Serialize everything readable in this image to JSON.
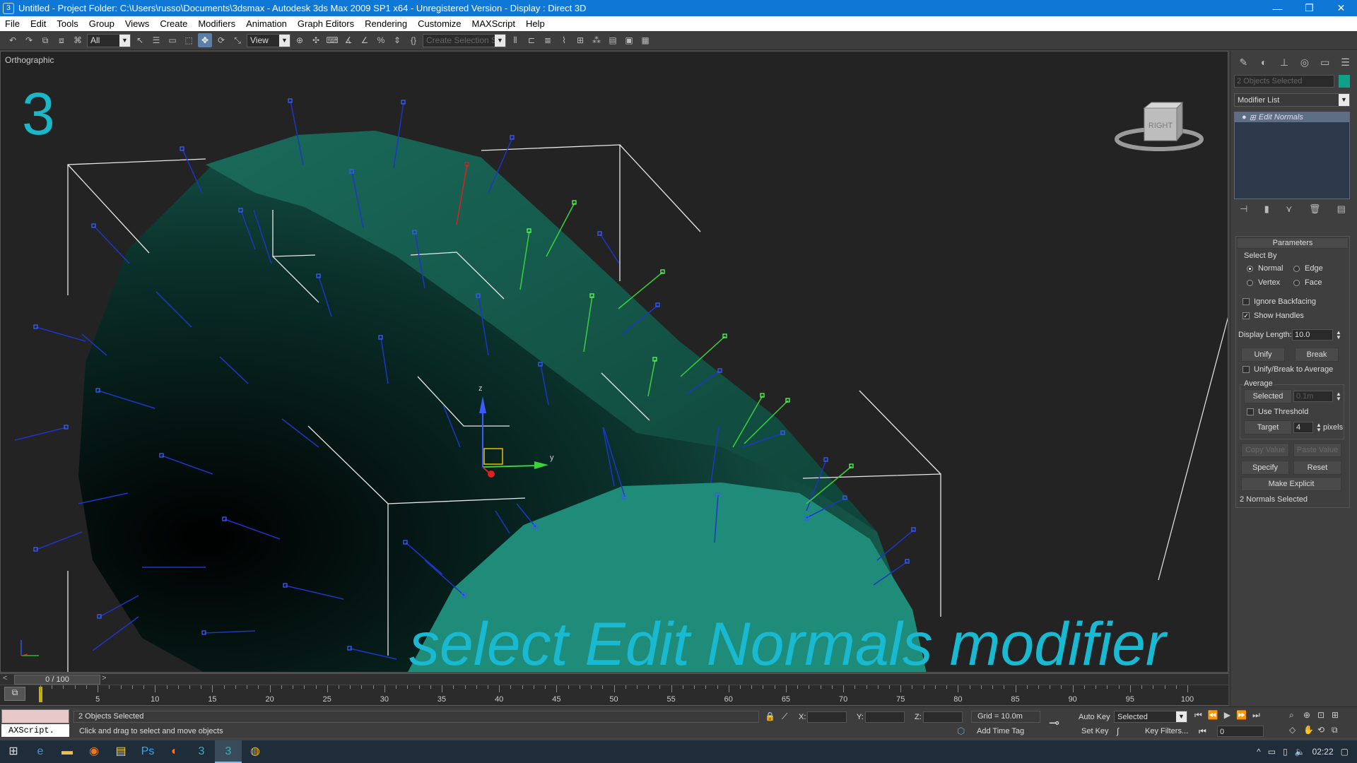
{
  "window": {
    "title": "Untitled     - Project Folder: C:\\Users\\russo\\Documents\\3dsmax     - Autodesk 3ds Max  2009 SP1  x64  - Unregistered Version          - Display : Direct 3D",
    "app_icon": "3ds-max-icon",
    "controls": {
      "minimize": "—",
      "restore": "❐",
      "close": "✕"
    }
  },
  "menu": [
    "File",
    "Edit",
    "Tools",
    "Group",
    "Views",
    "Create",
    "Modifiers",
    "Animation",
    "Graph Editors",
    "Rendering",
    "Customize",
    "MAXScript",
    "Help"
  ],
  "toolbar": {
    "selection_filter": "All",
    "ref_coord": "View",
    "named_selection": "Create Selection Se"
  },
  "viewport": {
    "label": "Orthographic",
    "step_number": "3",
    "caption": "select Edit Normals modifier",
    "viewcube_label": "RIGHT",
    "gizmo_labels": {
      "z": "z",
      "y": "y"
    },
    "mesh_color": "#1c6b5a",
    "normal_colors": {
      "default": "#1d36c8",
      "selected": "#3bd13b",
      "handle": "#e02020"
    },
    "caption_color": "#1ab9d2"
  },
  "command_panel": {
    "selection_field": "2 Objects Selected",
    "color_swatch": "#0fa08a",
    "modifier_list_label": "Modifier List",
    "stack_item": "Edit Normals",
    "rollout_title": "Parameters",
    "select_by": {
      "label": "Select By",
      "options": [
        {
          "label": "Normal",
          "checked": true
        },
        {
          "label": "Edge",
          "checked": false
        },
        {
          "label": "Vertex",
          "checked": false
        },
        {
          "label": "Face",
          "checked": false
        }
      ]
    },
    "ignore_backfacing": {
      "label": "Ignore Backfacing",
      "checked": false
    },
    "show_handles": {
      "label": "Show Handles",
      "checked": true
    },
    "display_length": {
      "label": "Display Length:",
      "value": "10.0"
    },
    "unify": "Unify",
    "break": "Break",
    "unify_break_avg": {
      "label": "Unify/Break to Average",
      "checked": false
    },
    "average": {
      "label": "Average",
      "selected_btn": "Selected",
      "selected_value": "0.1m",
      "use_threshold": {
        "label": "Use Threshold",
        "checked": false
      },
      "target_btn": "Target",
      "target_value": "4",
      "target_unit": "pixels"
    },
    "copy_value": "Copy Value",
    "paste_value": "Paste Value",
    "specify": "Specify",
    "reset": "Reset",
    "make_explicit": "Make Explicit",
    "status": "2 Normals Selected"
  },
  "timeline": {
    "frame": "0 / 100",
    "ticks": [
      "5",
      "10",
      "15",
      "20",
      "25",
      "30",
      "35",
      "40",
      "45",
      "50",
      "55",
      "60",
      "65",
      "70",
      "75",
      "80",
      "85",
      "90",
      "95",
      "100"
    ]
  },
  "status": {
    "maxscript": "AXScript.",
    "objects_selected": "2 Objects Selected",
    "prompt": "Click and drag to select and move objects",
    "x_label": "X:",
    "y_label": "Y:",
    "z_label": "Z:",
    "grid": "Grid = 10.0m",
    "add_time_tag": "Add Time Tag",
    "auto_key": "Auto Key",
    "auto_key_mode": "Selected",
    "set_key": "Set Key",
    "key_filters": "Key Filters...",
    "current_frame": "0"
  },
  "taskbar": {
    "apps": [
      "windows-start-icon",
      "edge-icon",
      "file-explorer-icon",
      "firefox-icon",
      "notepad-icon",
      "photoshop-icon",
      "blender-icon",
      "3dsmax-icon",
      "3dsmax-active-icon",
      "chrome-icon"
    ],
    "time": "02:22"
  }
}
